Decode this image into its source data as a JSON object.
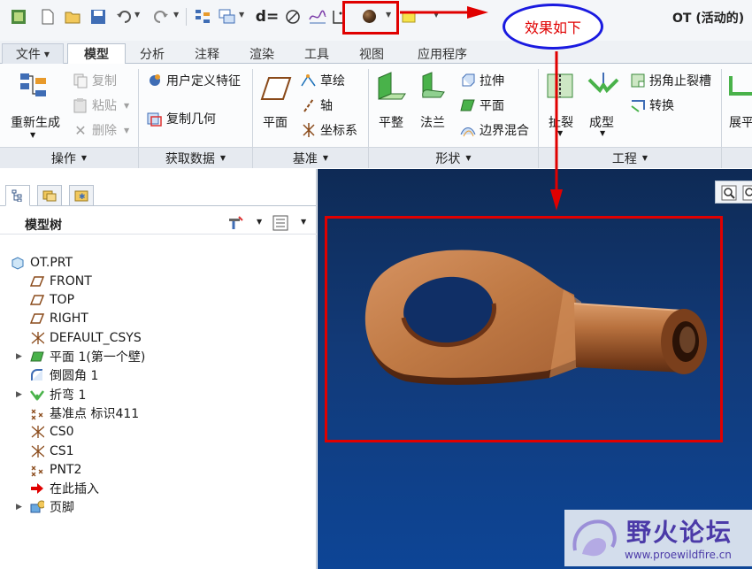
{
  "window": {
    "title": "OT (活动的)"
  },
  "annotation": {
    "callout_text": "效果如下",
    "arrow_color": "#e00000",
    "box_color": "#e00000",
    "callout_border": "#1a1ae0"
  },
  "quick_access": {
    "items": [
      "new-file-icon",
      "open-file-icon",
      "save-icon",
      "undo-icon",
      "redo-icon",
      "regenerate-icon",
      "windows-icon",
      "dimension-icon",
      "measure-icon",
      "curve-icon",
      "plane-display-icon",
      "shading-icon",
      "color-swatch-icon"
    ],
    "dimension_label": "d="
  },
  "tabs": [
    {
      "id": "file",
      "label": "文件"
    },
    {
      "id": "model",
      "label": "模型"
    },
    {
      "id": "analysis",
      "label": "分析"
    },
    {
      "id": "annotate",
      "label": "注释"
    },
    {
      "id": "render",
      "label": "渲染"
    },
    {
      "id": "tools",
      "label": "工具"
    },
    {
      "id": "view",
      "label": "视图"
    },
    {
      "id": "apps",
      "label": "应用程序"
    }
  ],
  "ribbon": {
    "operations": {
      "regenerate": "重新生成",
      "copy": "复制",
      "paste": "粘贴",
      "delete": "删除",
      "group": "操作"
    },
    "get_data": {
      "udf": "用户定义特征",
      "copy_geom": "复制几何",
      "group": "获取数据"
    },
    "datum": {
      "plane": "平面",
      "sketch": "草绘",
      "axis": "轴",
      "csys": "坐标系",
      "group": "基准"
    },
    "shapes": {
      "flat": "平整",
      "flange": "法兰",
      "extrude": "拉伸",
      "planar": "平面",
      "blend": "边界混合",
      "group": "形状"
    },
    "engineering": {
      "tear": "扯裂",
      "form": "成型",
      "corner_relief": "拐角止裂槽",
      "convert": "转换",
      "group": "工程"
    },
    "unbend": {
      "label": "展平"
    }
  },
  "model_tree": {
    "title": "模型树",
    "items": [
      {
        "label": "OT.PRT",
        "icon": "part-icon",
        "expandable": false
      },
      {
        "label": "FRONT",
        "icon": "datum-plane-icon",
        "expandable": false
      },
      {
        "label": "TOP",
        "icon": "datum-plane-icon",
        "expandable": false
      },
      {
        "label": "RIGHT",
        "icon": "datum-plane-icon",
        "expandable": false
      },
      {
        "label": "DEFAULT_CSYS",
        "icon": "csys-icon",
        "expandable": false
      },
      {
        "label": "平面 1(第一个壁)",
        "icon": "planar-wall-icon",
        "expandable": true
      },
      {
        "label": "倒圆角 1",
        "icon": "round-icon",
        "expandable": false
      },
      {
        "label": "折弯 1",
        "icon": "bend-icon",
        "expandable": true
      },
      {
        "label": "基准点 标识411",
        "icon": "datum-point-icon",
        "expandable": false
      },
      {
        "label": "CS0",
        "icon": "csys-icon",
        "expandable": false
      },
      {
        "label": "CS1",
        "icon": "csys-icon",
        "expandable": false
      },
      {
        "label": "PNT2",
        "icon": "datum-point-icon",
        "expandable": false
      },
      {
        "label": "在此插入",
        "icon": "insert-here-icon",
        "expandable": false
      },
      {
        "label": "页脚",
        "icon": "footer-icon",
        "expandable": true
      }
    ]
  },
  "watermark": {
    "title": "野火论坛",
    "url": "www.proewildfire.cn"
  },
  "colors": {
    "viewport_top": "#0e2a55",
    "viewport_bottom": "#0d4596",
    "copper": "#c07a45",
    "accent": "#2f6fb8"
  }
}
